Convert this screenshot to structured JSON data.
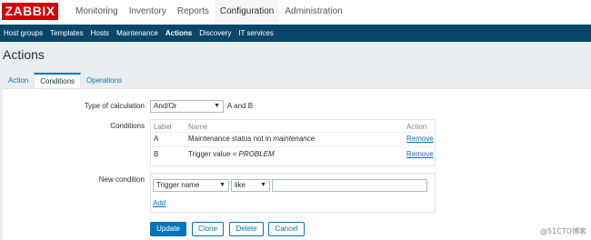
{
  "brand": {
    "logo": "ZABBIX"
  },
  "top_nav": [
    "Monitoring",
    "Inventory",
    "Reports",
    "Configuration",
    "Administration"
  ],
  "sub_nav": [
    "Host groups",
    "Templates",
    "Hosts",
    "Maintenance",
    "Actions",
    "Discovery",
    "IT services"
  ],
  "page_title": "Actions",
  "tabs": [
    "Action",
    "Conditions",
    "Operations"
  ],
  "form": {
    "type_of_calculation": {
      "label": "Type of calculation",
      "value": "And/Or",
      "expression": "A and B"
    },
    "conditions": {
      "label": "Conditions",
      "headers": {
        "label": "Label",
        "name": "Name",
        "action": "Action"
      },
      "rows": [
        {
          "label": "A",
          "name_prefix": "Maintenance status not in ",
          "name_em": "maintenance",
          "action": "Remove"
        },
        {
          "label": "B",
          "name_prefix": "Trigger value = ",
          "name_em": "PROBLEM",
          "action": "Remove"
        }
      ]
    },
    "new_condition": {
      "label": "New condition",
      "type": "Trigger name",
      "operator": "like",
      "value": "",
      "add": "Add"
    }
  },
  "buttons": {
    "update": "Update",
    "clone": "Clone",
    "delete": "Delete",
    "cancel": "Cancel"
  },
  "watermark": "@51CTO博客",
  "colors": {
    "brand_red": "#d40000",
    "nav_blue": "#0a466a",
    "link_blue": "#0275b8"
  }
}
